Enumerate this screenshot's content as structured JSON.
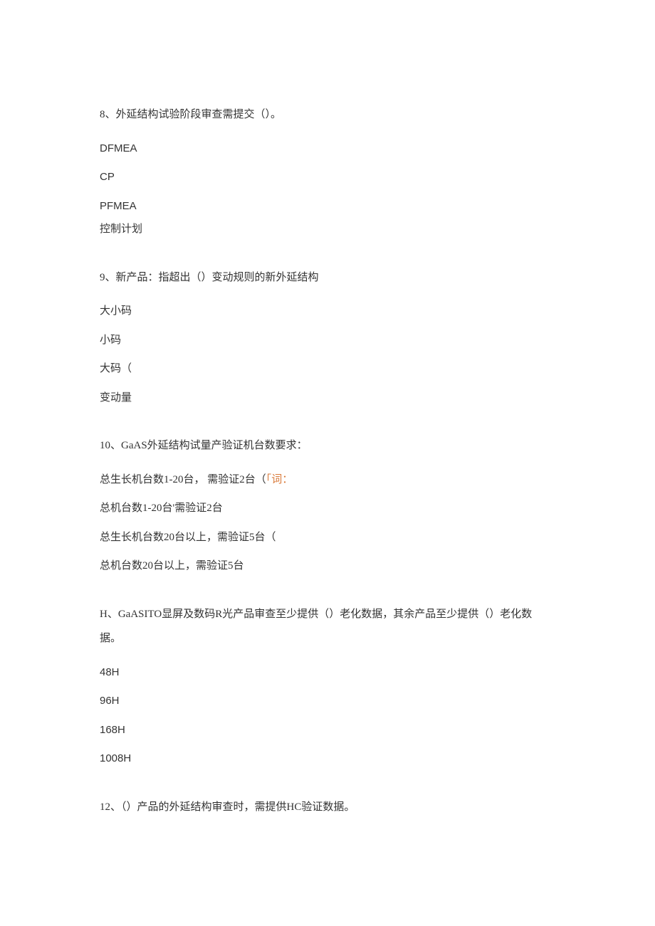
{
  "questions": [
    {
      "title": "8、外延结构试验阶段审查需提交（）。",
      "options": [
        {
          "text": "DFMEA",
          "isLatin": true
        },
        {
          "text": "CP",
          "isLatin": true
        },
        {
          "text": "PFMEA",
          "isLatin": true
        },
        {
          "text": "控制计划",
          "isLatin": false
        }
      ]
    },
    {
      "title": "9、新产品：指超出（）变动规则的新外延结构",
      "options": [
        {
          "text": "大小码",
          "isLatin": false
        },
        {
          "text": "小码",
          "isLatin": false
        },
        {
          "text": "大码（",
          "isLatin": false
        },
        {
          "text": "变动量",
          "isLatin": false
        }
      ]
    },
    {
      "title": "10、GaAS外延结构试量产验证机台数要求：",
      "options": [
        {
          "prefix": "总生长机台数1-20台， 需验证2台（",
          "orange": "「词：",
          "suffix": ""
        },
        {
          "prefix": "总机台数1-20台'需验证2台",
          "orange": "",
          "suffix": ""
        },
        {
          "prefix": "总生长机台数20台以上，需验证5台（",
          "orange": "",
          "suffix": ""
        },
        {
          "prefix": "总机台数20台以上，需验证5台",
          "orange": "",
          "suffix": ""
        }
      ]
    },
    {
      "titleLine1": "H、GaASITO显屏及数码R光产品审查至少提供（）老化数据，其余产品至少提供（）老化数",
      "titleLine2": "据。",
      "options": [
        {
          "text": "48H",
          "isLatin": true
        },
        {
          "text": "96H",
          "isLatin": true
        },
        {
          "text": "168H",
          "isLatin": true
        },
        {
          "text": "1008H",
          "isLatin": true
        }
      ]
    },
    {
      "title": "12、（）产品的外延结构审查时，需提供HC验证数据。"
    }
  ]
}
